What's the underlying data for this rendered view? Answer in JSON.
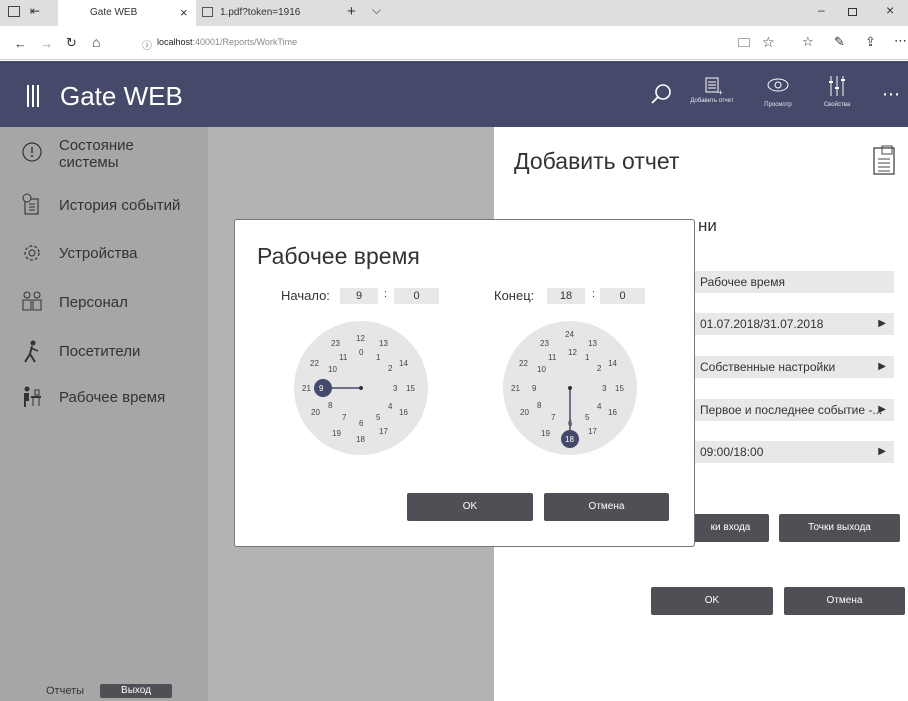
{
  "browser": {
    "tab_title": "Gate WEB",
    "tab2_title": "1.pdf?token=1916",
    "url_host": "localhost",
    "url_path": ":40001/Reports/WorkTime"
  },
  "app": {
    "title": "Gate WEB",
    "toolbar": {
      "add_report": "Добавить отчет",
      "preview": "Просмотр",
      "properties": "Свойства"
    }
  },
  "sidebar": {
    "items": [
      {
        "label": "Состояние системы",
        "icon": "system-status-icon"
      },
      {
        "label": "История событий",
        "icon": "event-history-icon"
      },
      {
        "label": "Устройства",
        "icon": "devices-icon"
      },
      {
        "label": "Персонал",
        "icon": "personnel-icon"
      },
      {
        "label": "Посетители",
        "icon": "visitors-icon"
      },
      {
        "label": "Рабочее время",
        "icon": "work-time-icon"
      }
    ],
    "footer_reports": "Отчеты",
    "exit": "Выход"
  },
  "panel": {
    "title": "Добавить отчет",
    "subtitle_tail": "ни",
    "fields": [
      "Рабочее время",
      "01.07.2018/31.07.2018",
      "Собственные настройки",
      "Первое и последнее событие -...",
      "09:00/18:00"
    ],
    "entry_points": "Точки входа",
    "entry_points_visible": "ки входа",
    "exit_points": "Точки выхода",
    "ok": "OK",
    "cancel": "Отмена"
  },
  "modal": {
    "title": "Рабочее время",
    "start_label": "Начало:",
    "start_hour": "9",
    "start_minute": "0",
    "end_label": "Конец:",
    "end_hour": "18",
    "end_minute": "0",
    "separator": ":",
    "ok": "OK",
    "cancel": "Отмена"
  },
  "colors": {
    "header": "#454a6a",
    "selected_hour": "#454a6a",
    "button": "#4f4f55"
  }
}
